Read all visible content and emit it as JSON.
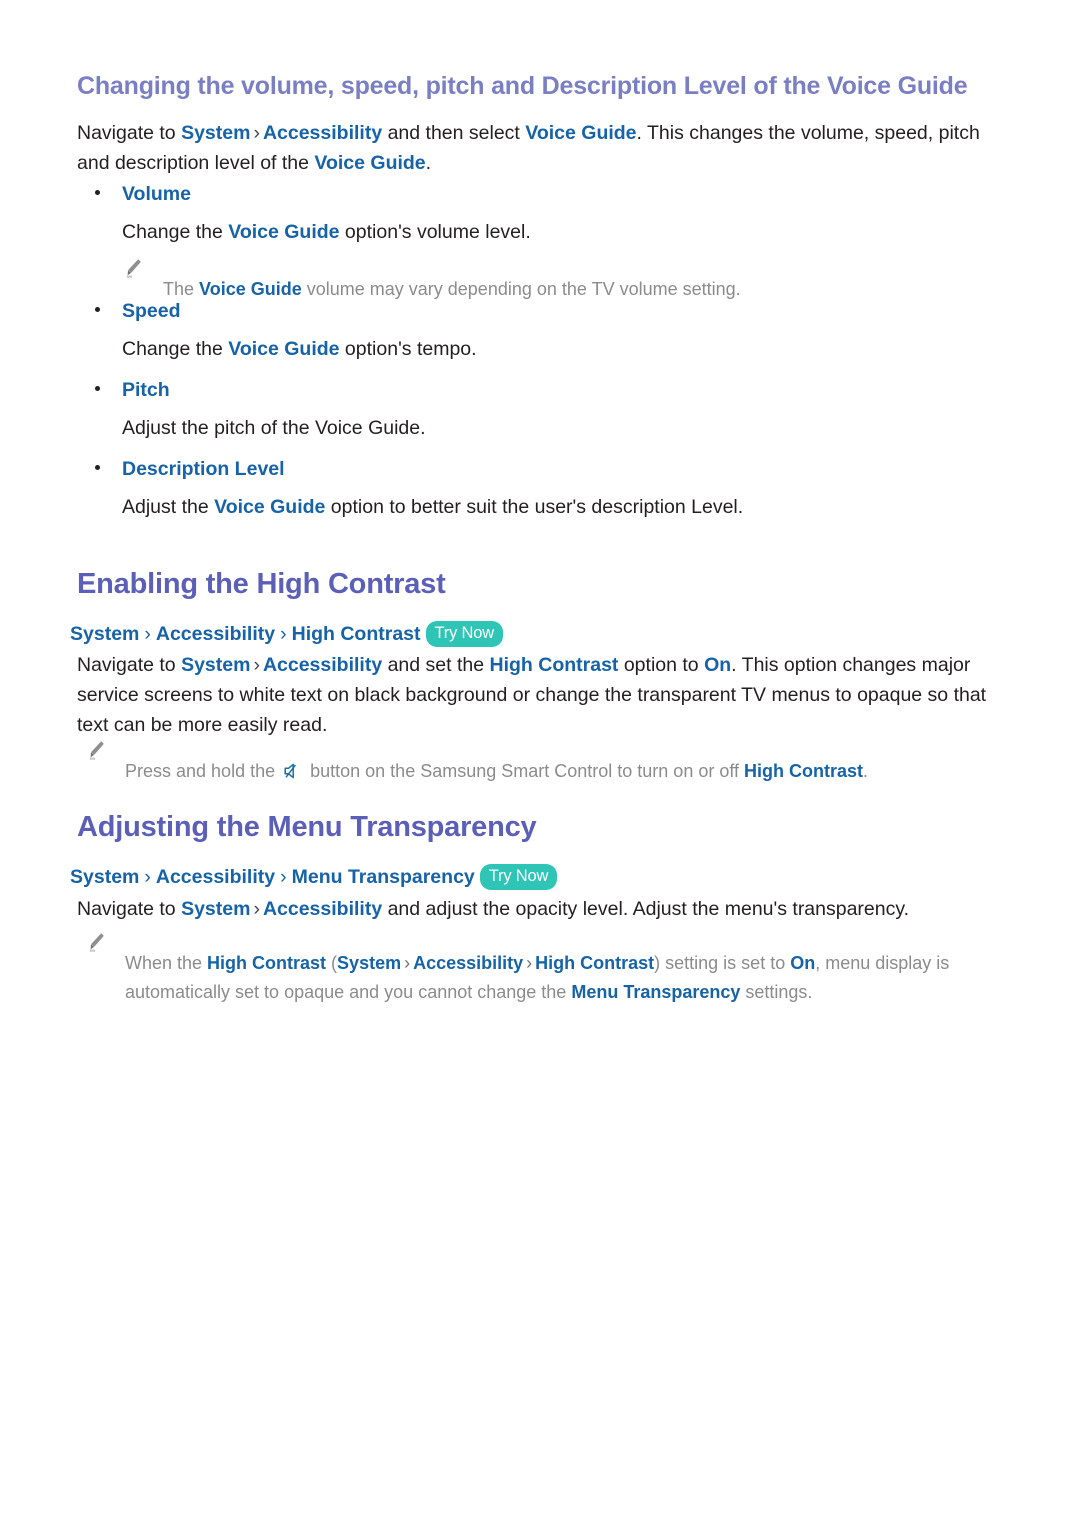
{
  "document": {
    "section1": {
      "heading": "Changing the volume, speed, pitch and Description Level of the Voice Guide",
      "intro": {
        "t1": "Navigate to ",
        "l1": "System",
        "sep1": "›",
        "l2": "Accessibility",
        "t2": " and then select ",
        "l3": "Voice Guide",
        "t3": ". This changes the volume, speed, pitch and description level of the ",
        "l4": "Voice Guide",
        "t4": "."
      },
      "bullets": [
        {
          "label": "Volume",
          "desc_pre": "Change the ",
          "desc_link": "Voice Guide",
          "desc_post": " option's volume level.",
          "note": {
            "pre": "The ",
            "link": "Voice Guide",
            "post": " volume may vary depending on the TV volume setting."
          }
        },
        {
          "label": "Speed",
          "desc_pre": "Change the ",
          "desc_link": "Voice Guide",
          "desc_post": " option's tempo."
        },
        {
          "label": "Pitch",
          "desc_pre": "Adjust the pitch of the Voice Guide.",
          "desc_link": "",
          "desc_post": ""
        },
        {
          "label": "Description Level",
          "desc_pre": "Adjust the ",
          "desc_link": "Voice Guide",
          "desc_post": " option to better suit the user's description Level."
        }
      ]
    },
    "section2": {
      "heading": "Enabling the High Contrast",
      "breadcrumb": {
        "c1": "System",
        "sep1": "›",
        "c2": "Accessibility",
        "sep2": "›",
        "c3": "High Contrast",
        "badge": "Try Now"
      },
      "body": {
        "t1": "Navigate to ",
        "l1": "System",
        "sep1": "›",
        "l2": "Accessibility",
        "t2": " and set the ",
        "l3": "High Contrast",
        "t3": " option to ",
        "l4": "On",
        "t4": ". This option changes major service screens to white text on black background or change the transparent TV menus to opaque so that text can be more easily read."
      },
      "note": {
        "pre": "Press and hold the ",
        "icon": "mute-icon",
        "mid": " button on the Samsung Smart Control to turn on or off ",
        "link": "High Contrast",
        "post": "."
      }
    },
    "section3": {
      "heading": "Adjusting the Menu Transparency",
      "breadcrumb": {
        "c1": "System",
        "sep1": "›",
        "c2": "Accessibility",
        "sep2": "›",
        "c3": "Menu Transparency",
        "badge": "Try Now"
      },
      "body": {
        "t1": "Navigate to ",
        "l1": "System",
        "sep1": "›",
        "l2": "Accessibility",
        "t2": " and adjust the opacity level. Adjust the menu's transparency."
      },
      "note": {
        "p1": "When the ",
        "l1": "High Contrast",
        "p2": " (",
        "l2": "System",
        "sep1": "›",
        "l3": "Accessibility",
        "sep2": "›",
        "l4": "High Contrast",
        "p3": ") setting is set to ",
        "l5": "On",
        "p4": ", menu display is automatically set to opaque and you cannot change the ",
        "l6": "Menu Transparency",
        "p5": " settings."
      }
    }
  },
  "colors": {
    "heading_sub": "#7a7fc3",
    "heading_main": "#5b5fb8",
    "link": "#1663a8",
    "badge_bg": "#2ec4b6",
    "note_text": "#8b8b8b",
    "body_text": "#231f20"
  }
}
